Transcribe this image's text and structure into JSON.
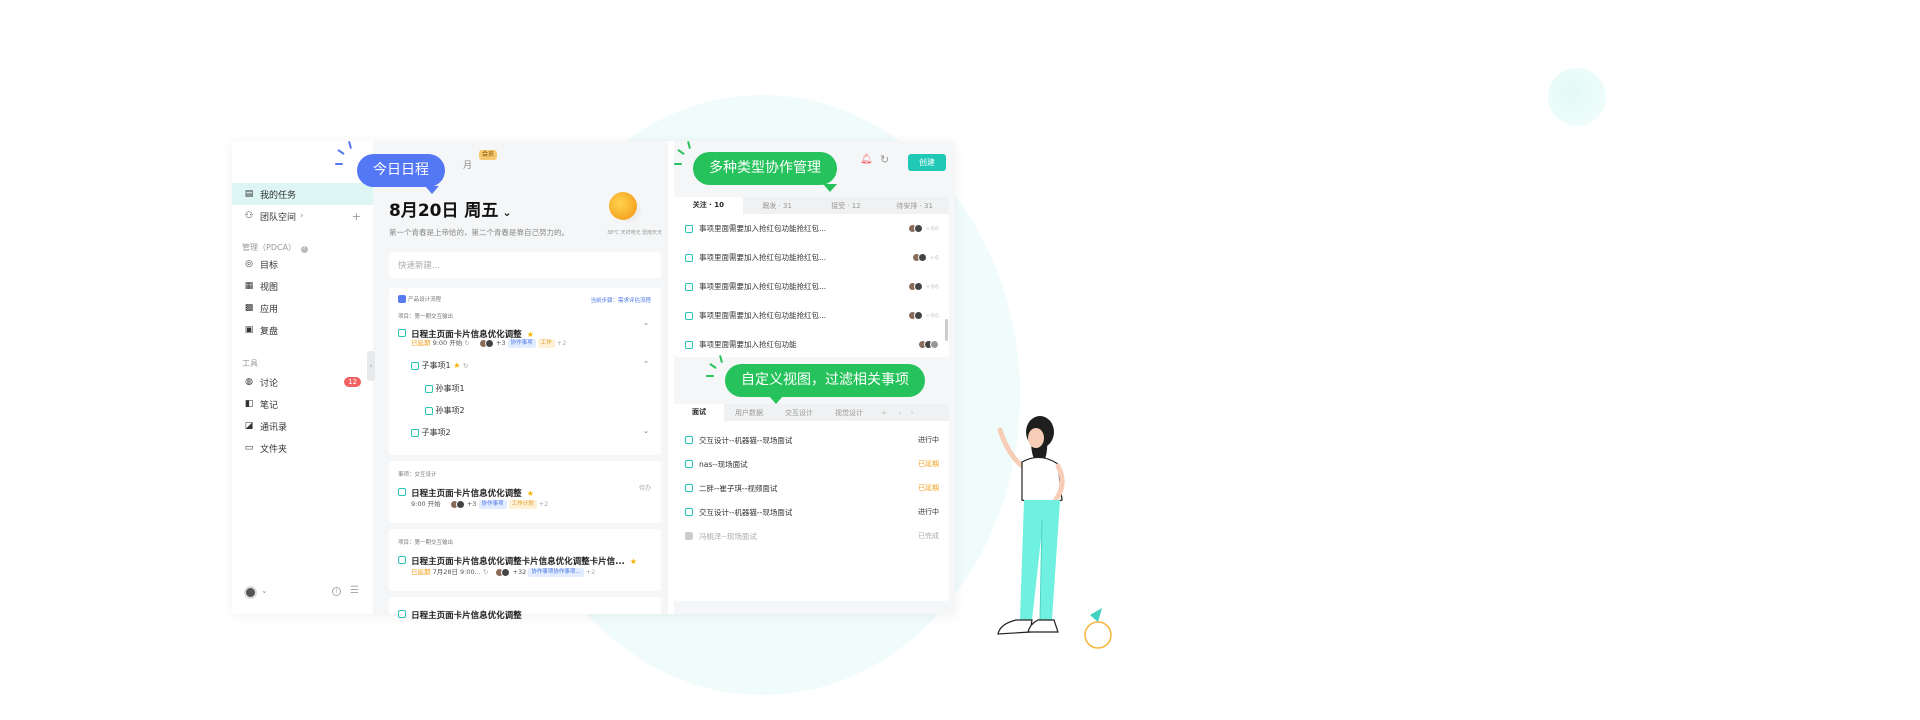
{
  "window": {
    "traffic_colors": [
      "#f25f58",
      "#f9be2e",
      "#3ac54a"
    ]
  },
  "sidebar": {
    "my_tasks": "我的任务",
    "team_space": "团队空间",
    "manage_header": "管理（PDCA）",
    "manage_items": [
      {
        "label": "目标",
        "icon": "target-icon"
      },
      {
        "label": "视图",
        "icon": "view-icon"
      },
      {
        "label": "应用",
        "icon": "apps-icon"
      },
      {
        "label": "复盘",
        "icon": "review-icon"
      }
    ],
    "tools_header": "工具",
    "tool_items": [
      {
        "label": "讨论",
        "icon": "chat-icon",
        "badge": "12"
      },
      {
        "label": "笔记",
        "icon": "note-icon"
      },
      {
        "label": "通讯录",
        "icon": "contacts-icon"
      },
      {
        "label": "文件夹",
        "icon": "folder-icon"
      }
    ]
  },
  "header": {
    "month_tab": "月",
    "vip_badge": "会员",
    "create_button": "创建"
  },
  "bubbles": {
    "today": "今日日程",
    "collab": "多种类型协作管理",
    "custom_view": "自定义视图，过滤相关事项"
  },
  "middle": {
    "date": "8月20日 周五",
    "motto": "第一个青春是上帝给的，第二个青春是靠自己努力的。",
    "weather": "38℃ 天祥电光 雷雨天天",
    "quick_placeholder": "快速新建...",
    "card1": {
      "flow_name": "产品设计流程",
      "flow_links": "当前步骤：需求评估流程",
      "project": "项目：第一期交互输出",
      "title": "日程主页面卡片信息优化调整",
      "status": "已延期",
      "time": "9:00 开始",
      "avatar_count": "+3",
      "tags": [
        "协作事项",
        "工作"
      ],
      "more": "+2",
      "sub1": "子事项1",
      "grand1": "孙事项1",
      "grand2": "孙事项2",
      "sub2": "子事项2"
    },
    "card2": {
      "project": "事项：交互设计",
      "title": "日程主页面卡片信息优化调整",
      "status": "待办",
      "time": "9:00 开始",
      "avatar_count": "+3",
      "tags": [
        "协作事项",
        "工作计划"
      ],
      "more": "+2"
    },
    "card3": {
      "project": "项目：第一期交互输出",
      "title": "日程主页面卡片信息优化调整卡片信息优化调整卡片信...",
      "status": "已延期",
      "time": "7月28日 9:00...",
      "avatar_count": "+32",
      "tags": [
        "协作事项协作事项..."
      ],
      "more": "+2"
    },
    "card4": {
      "title": "日程主页面卡片信息优化调整"
    }
  },
  "right": {
    "tabs1": [
      "关注 · 10",
      "跟发 · 31",
      "接受 · 12",
      "待安排 · 31"
    ],
    "rows1": [
      {
        "text": "事项里面需要加入抢红包功能抢红包...",
        "count": "+86"
      },
      {
        "text": "事项里面需要加入抢红包功能抢红包...",
        "count": "+6"
      },
      {
        "text": "事项里面需要加入抢红包功能抢红包...",
        "count": "+86"
      },
      {
        "text": "事项里面需要加入抢红包功能抢红包...",
        "count": "+86"
      },
      {
        "text": "事项里面需要加入抢红包功能",
        "count": ""
      }
    ],
    "tabs2": [
      "面试",
      "用户数据",
      "交互设计",
      "视觉设计"
    ],
    "rows2": [
      {
        "text": "交互设计--机器猫--现场面试",
        "status": "进行中",
        "color": "#333333"
      },
      {
        "text": "nas--现场面试",
        "status": "已延期",
        "color": "#f0a020"
      },
      {
        "text": "二胖--崔子琪--视频面试",
        "status": "已延期",
        "color": "#f0a020"
      },
      {
        "text": "交互设计--机器猫--现场面试",
        "status": "进行中",
        "color": "#333333"
      },
      {
        "text": "冯桃泽--现场面试",
        "status": "已完成",
        "color": "#aaaaaa"
      }
    ]
  }
}
